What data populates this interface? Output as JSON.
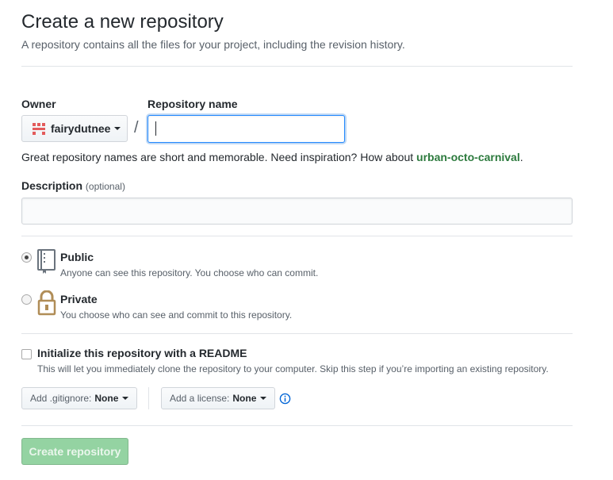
{
  "header": {
    "title": "Create a new repository",
    "subtitle": "A repository contains all the files for your project, including the revision history."
  },
  "owner": {
    "label": "Owner",
    "value": "fairydutnee"
  },
  "repo_name": {
    "label": "Repository name",
    "value": "",
    "separator": "/"
  },
  "hint": {
    "text": "Great repository names are short and memorable. Need inspiration? How about ",
    "suggestion": "urban-octo-carnival",
    "end": "."
  },
  "description": {
    "label": "Description",
    "optional": "(optional)",
    "value": ""
  },
  "visibility": {
    "public": {
      "title": "Public",
      "note": "Anyone can see this repository. You choose who can commit.",
      "selected": true
    },
    "private": {
      "title": "Private",
      "note": "You choose who can see and commit to this repository.",
      "selected": false
    }
  },
  "readme": {
    "title": "Initialize this repository with a README",
    "note": "This will let you immediately clone the repository to your computer. Skip this step if you’re importing an existing repository.",
    "checked": false
  },
  "gitignore": {
    "label": "Add .gitignore:",
    "value": "None"
  },
  "license": {
    "label": "Add a license:",
    "value": "None"
  },
  "submit": {
    "label": "Create repository"
  },
  "colors": {
    "accent_blue": "#0366d6",
    "identicon": "#e35b5b",
    "suggestion_green": "#2c7a3d",
    "button_disabled_green": "#94d3a2",
    "lock_gold": "#b08d57"
  },
  "icons": {
    "owner_avatar": "identicon",
    "public": "repo-book-icon",
    "private": "lock-icon",
    "license_info": "info-icon",
    "dropdown": "caret-down-icon"
  }
}
